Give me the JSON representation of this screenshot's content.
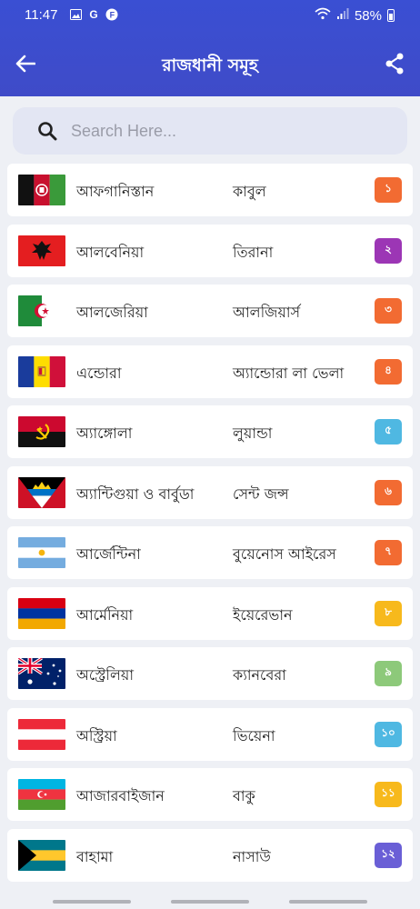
{
  "status": {
    "time": "11:47",
    "battery": "58%",
    "left_icons": [
      "image-icon",
      "G",
      "F"
    ]
  },
  "appbar": {
    "title": "রাজধানী সমূহ"
  },
  "search": {
    "placeholder": "Search Here..."
  },
  "colors": {
    "header": "#3d4ecb",
    "badge_orange": "#f26b32",
    "badge_purple": "#9c36b5",
    "badge_blue": "#4fb8e2",
    "badge_yellow": "#f7b91c",
    "badge_green": "#8dc97a",
    "badge_violet": "#6a5fd6"
  },
  "rows": [
    {
      "country": "আফগানিস্তান",
      "capital": "কাবুল",
      "number": "১",
      "badge_color": "#f26b32",
      "flag": "afghanistan"
    },
    {
      "country": "আলবেনিয়া",
      "capital": "তিরানা",
      "number": "২",
      "badge_color": "#9c36b5",
      "flag": "albania"
    },
    {
      "country": "আলজেরিয়া",
      "capital": "আলজিয়ার্স",
      "number": "৩",
      "badge_color": "#f26b32",
      "flag": "algeria"
    },
    {
      "country": "এন্ডোরা",
      "capital": "অ্যান্ডোরা লা ভেলা",
      "number": "৪",
      "badge_color": "#f26b32",
      "flag": "andorra"
    },
    {
      "country": "অ্যাঙ্গোলা",
      "capital": "লুয়ান্ডা",
      "number": "৫",
      "badge_color": "#4fb8e2",
      "flag": "angola"
    },
    {
      "country": "অ্যান্টিগুয়া ও বার্বুডা",
      "capital": "সেন্ট জন্স",
      "number": "৬",
      "badge_color": "#f26b32",
      "flag": "antigua"
    },
    {
      "country": "আর্জেন্টিনা",
      "capital": "বুয়েনোস আইরেস",
      "number": "৭",
      "badge_color": "#f26b32",
      "flag": "argentina"
    },
    {
      "country": "আর্মেনিয়া",
      "capital": "ইয়েরেভান",
      "number": "৮",
      "badge_color": "#f7b91c",
      "flag": "armenia"
    },
    {
      "country": "অস্ট্রেলিয়া",
      "capital": "ক্যানবেরা",
      "number": "৯",
      "badge_color": "#8dc97a",
      "flag": "australia"
    },
    {
      "country": "অস্ট্রিয়া",
      "capital": "ভিয়েনা",
      "number": "১০",
      "badge_color": "#4fb8e2",
      "flag": "austria"
    },
    {
      "country": "আজারবাইজান",
      "capital": "বাকু",
      "number": "১১",
      "badge_color": "#f7b91c",
      "flag": "azerbaijan"
    },
    {
      "country": "বাহামা",
      "capital": "নাসাউ",
      "number": "১২",
      "badge_color": "#6a5fd6",
      "flag": "bahamas"
    }
  ]
}
